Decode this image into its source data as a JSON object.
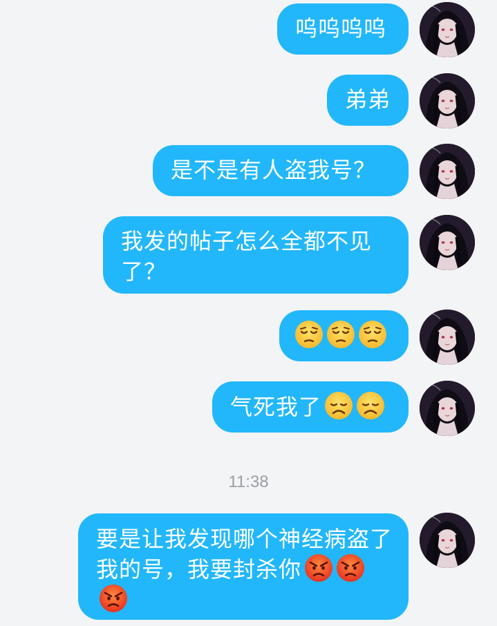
{
  "messages": [
    {
      "text": "呜呜呜呜",
      "emojis": []
    },
    {
      "text": "弟弟",
      "emojis": []
    },
    {
      "text": "是不是有人盗我号？",
      "emojis": []
    },
    {
      "text": "我发的帖子怎么全都不见了？",
      "emojis": []
    },
    {
      "text": "",
      "emojis": [
        "pensive-face",
        "pensive-face",
        "pensive-face"
      ]
    },
    {
      "text": "气死我了",
      "emojis": [
        "disappointed-face",
        "disappointed-face"
      ]
    },
    {
      "text": "要是让我发现哪个神经病盗了我的号，我要封杀你",
      "emojis": [
        "angry-face",
        "angry-face",
        "angry-face"
      ]
    }
  ],
  "timestamp": "11:38",
  "colors": {
    "bubble": "#22b7fb",
    "background": "#f3f4f6",
    "timestamp": "#9a9ea5"
  }
}
